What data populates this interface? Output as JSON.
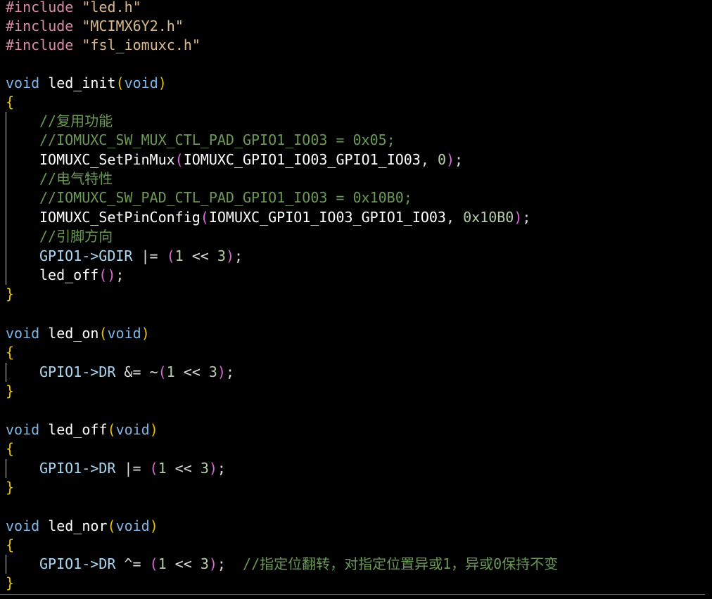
{
  "code": {
    "include_kw": "#include",
    "includes": [
      "\"led.h\"",
      "\"MCIMX6Y2.h\"",
      "\"fsl_iomuxc.h\""
    ],
    "void_kw": "void",
    "lbrace": "{",
    "rbrace": "}",
    "lparen": "(",
    "rparen": ")",
    "semi": ";",
    "comma": ", ",
    "func_led_init": "led_init",
    "func_led_on": "led_on",
    "func_led_off": "led_off",
    "func_led_nor": "led_nor",
    "comment_mux": "//复用功能",
    "comment_mux_reg": "//IOMUXC_SW_MUX_CTL_PAD_GPIO1_IO03 = 0x05;",
    "setpinmux_fn": "IOMUXC_SetPinMux",
    "pin_name": "IOMUXC_GPIO1_IO03_GPIO1_IO03",
    "zero": "0",
    "comment_elec": "//电气特性",
    "comment_pad_reg": "//IOMUXC_SW_PAD_CTL_PAD_GPIO1_IO03 = 0x10B0;",
    "setpinconfig_fn": "IOMUXC_SetPinConfig",
    "config_value": "0x10B0",
    "comment_dir": "//引脚方向",
    "gdir_target": "GPIO1->GDIR",
    "dr_target": "GPIO1->DR",
    "op_or": " |= ",
    "op_and": " &= ~",
    "op_xor": " ^= ",
    "one": "1",
    "shift": " << ",
    "three": "3",
    "led_off_call": "led_off",
    "empty_call": "()",
    "comment_nor": "  //指定位翻转，对指定位置异或1，异或0保持不变"
  }
}
